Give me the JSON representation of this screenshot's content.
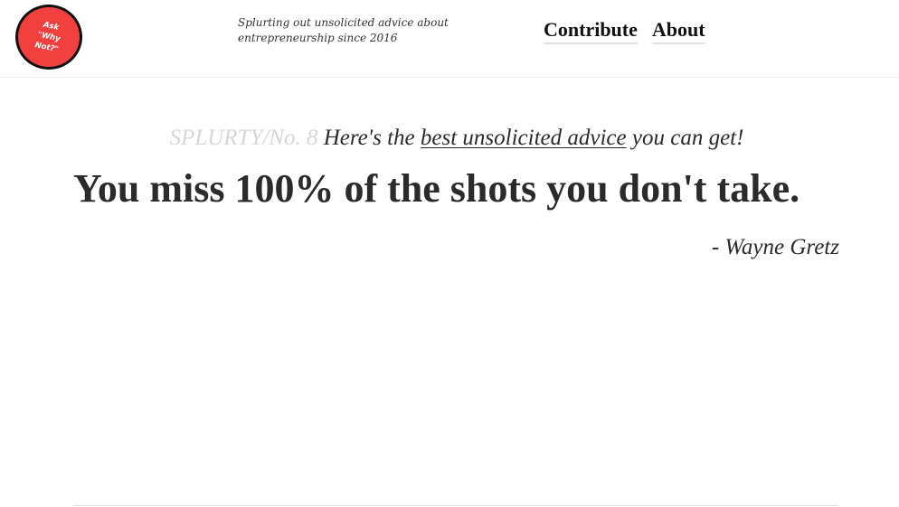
{
  "header": {
    "logo_text": "Ask\n\"Why\nNot?\"",
    "tagline": "Splurting out unsolicited advice about entrepreneurship since 2016",
    "nav": {
      "contribute": "Contribute",
      "about": "About"
    }
  },
  "main": {
    "intro": {
      "counter": "SPLURTY/No. 8",
      "prefix": "Here's the",
      "link_text": "best unsolicited advice",
      "suffix": "you can get!"
    },
    "quote": "You miss 100% of the shots you don't take.",
    "author": "- Wayne Gretz"
  },
  "colors": {
    "logo_fill": "#f2403f",
    "logo_border": "#111111",
    "text": "#2b2b2b",
    "counter": "#d6d6d6",
    "divider": "#e2e2e2"
  }
}
